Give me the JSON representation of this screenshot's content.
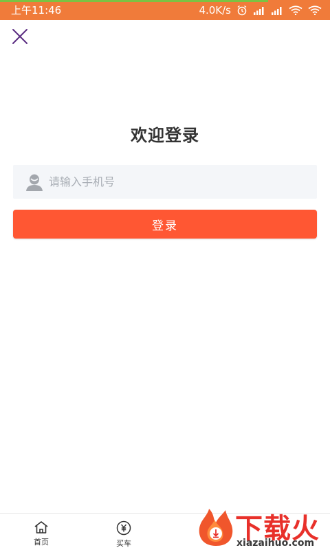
{
  "status_bar": {
    "time": "上午11:46",
    "net_speed": "4.0K/s",
    "icons": [
      "alarm-icon",
      "signal-icon",
      "signal-icon",
      "wifi-icon",
      "wifi-icon"
    ]
  },
  "header": {
    "close_icon": "close-icon"
  },
  "title": "欢迎登录",
  "phone_field": {
    "placeholder": "请输入手机号",
    "icon": "user-icon"
  },
  "login_button": {
    "label": "登录"
  },
  "tab_bar": {
    "items": [
      {
        "label": "首页",
        "icon": "home-icon"
      },
      {
        "label": "买车",
        "icon": "yuan-icon"
      }
    ]
  },
  "watermark": {
    "title": "下载火",
    "subtitle": "xiazaihuo.com"
  },
  "colors": {
    "status_bar": "#f07b3a",
    "accent": "#ff5733",
    "input_bg": "#f4f6f9",
    "close_icon": "#5b2d82"
  }
}
